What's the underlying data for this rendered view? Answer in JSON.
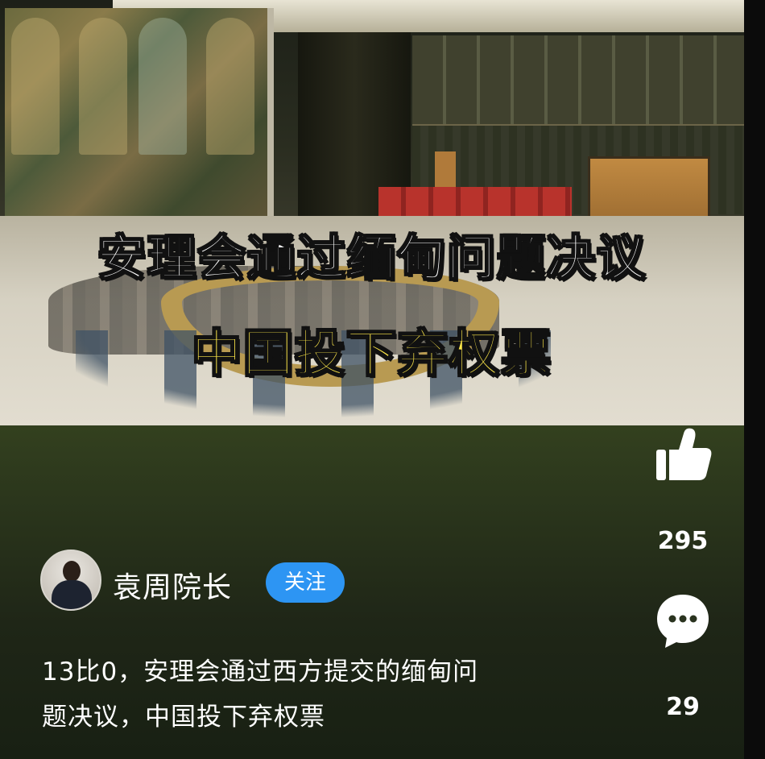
{
  "video": {
    "headline": "安理会通过缅甸问题决议",
    "subheadline": "中国投下弃权票"
  },
  "actions": {
    "like_icon": "thumbs-up-icon",
    "like_count": "295",
    "comment_icon": "comment-bubble-icon",
    "comment_count": "29"
  },
  "author": {
    "name": "袁周院长",
    "follow_label": "关注"
  },
  "description": {
    "line1": "13比0，安理会通过西方提交的缅甸问",
    "line2": "题决议，中国投下弃权票"
  },
  "colors": {
    "follow_button": "#2d95f3",
    "headline_text": "#ffffff",
    "subheadline_text": "#ffe94a"
  }
}
